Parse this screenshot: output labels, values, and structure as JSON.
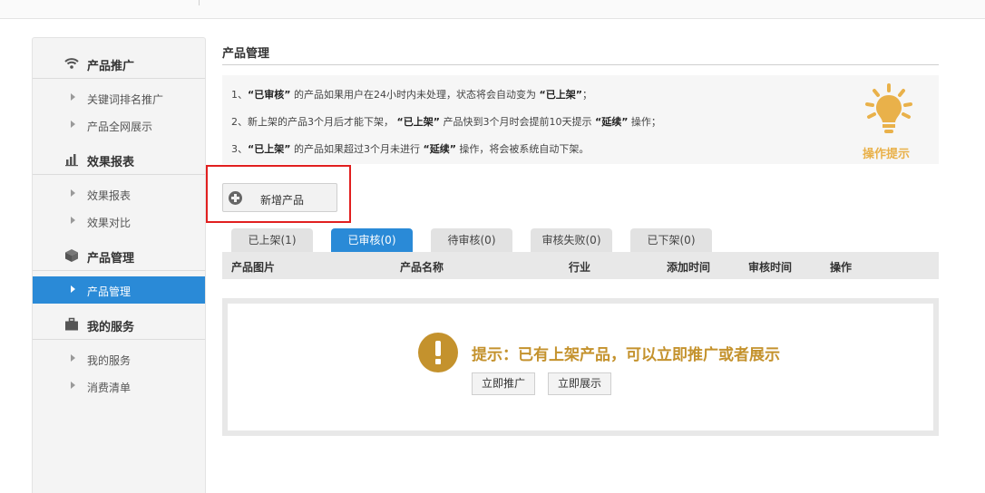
{
  "sidebar": {
    "sections": [
      {
        "title": "产品推广",
        "icon": "wifi-icon",
        "items": [
          "关键词排名推广",
          "产品全网展示"
        ]
      },
      {
        "title": "效果报表",
        "icon": "bar-chart-icon",
        "items": [
          "效果报表",
          "效果对比"
        ]
      },
      {
        "title": "产品管理",
        "icon": "cube-icon",
        "items": [
          "产品管理"
        ]
      },
      {
        "title": "我的服务",
        "icon": "briefcase-icon",
        "items": [
          "我的服务",
          "消费清单"
        ]
      }
    ],
    "active_item": "产品管理"
  },
  "main": {
    "title": "产品管理",
    "tips": {
      "line1": {
        "pre": "1、",
        "b1": "“已审核”",
        "mid": " 的产品如果用户在24小时内未处理，状态将会自动变为 ",
        "b2": "“已上架”",
        "post": "；"
      },
      "line2": {
        "pre": "2、新上架的产品3个月后才能下架， ",
        "b1": "“已上架”",
        "mid": " 产品快到3个月时会提前10天提示 ",
        "b2": "“延续”",
        "post": " 操作；"
      },
      "line3": {
        "pre": "3、",
        "b1": "“已上架”",
        "mid": " 的产品如果超过3个月未进行 ",
        "b2": "“延续”",
        "post": " 操作，将会被系统自动下架。"
      },
      "badge_label": "操作提示",
      "badge_icon": "lightbulb-icon",
      "badge_color": "#e9b14a"
    },
    "add_button": {
      "label": "新增产品",
      "icon": "plus-circle-icon"
    },
    "tabs": [
      "已上架(1)",
      "已审核(0)",
      "待审核(0)",
      "审核失败(0)",
      "已下架(0)"
    ],
    "active_tab": "已审核(0)",
    "columns": [
      "产品图片",
      "产品名称",
      "行业",
      "添加时间",
      "审核时间",
      "操作"
    ],
    "notice": {
      "text": "提示：已有上架产品，可以立即推广或者展示",
      "icon": "exclamation-circle-icon",
      "color": "#c4922d",
      "buttons": [
        "立即推广",
        "立即展示"
      ]
    }
  },
  "colors": {
    "accent": "#2a8ad7",
    "highlight_border": "#e11f1f"
  }
}
